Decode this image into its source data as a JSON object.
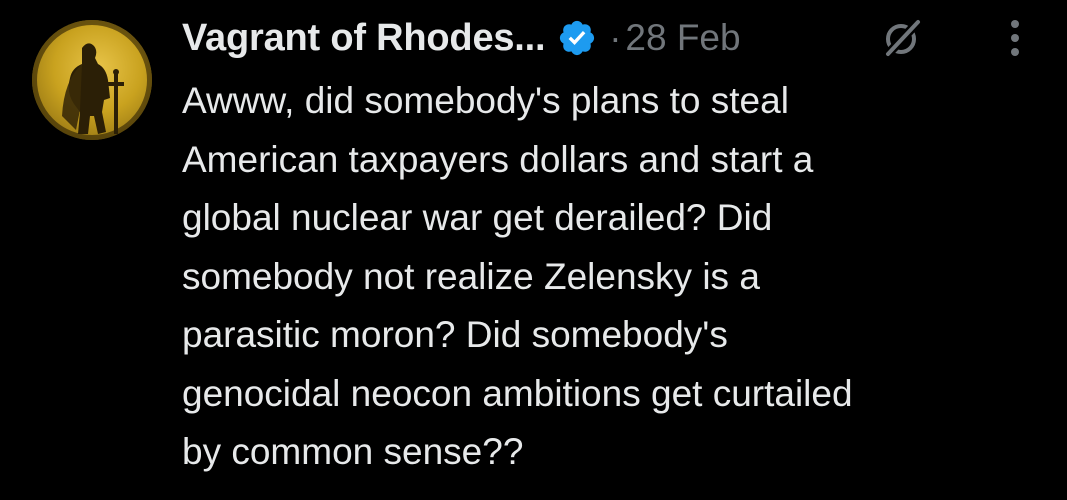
{
  "tweet": {
    "display_name": "Vagrant of Rhodes...",
    "separator": "·",
    "date": "28 Feb",
    "verified_icon": "verified-badge-icon",
    "grok_icon": "grok-icon",
    "more_icon": "more-options-icon",
    "avatar_icon": "armored-knight-avatar",
    "body_lines": [
      "Awww, did somebody's plans to steal",
      "American taxpayers dollars and start a",
      "global nuclear war get derailed? Did",
      "somebody not realize Zelensky is a",
      "parasitic moron? Did somebody's",
      "genocidal neocon ambitions get curtailed",
      "by common sense??"
    ]
  },
  "colors": {
    "background": "#000000",
    "text": "#e7e9ea",
    "muted": "#71767b",
    "verified_blue": "#1d9bf0",
    "avatar_gold": "#c9a21f"
  }
}
